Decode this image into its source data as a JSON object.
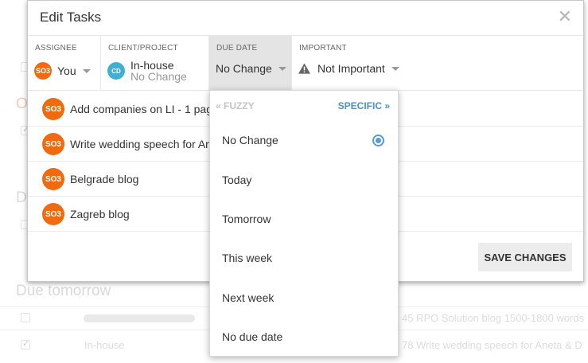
{
  "background": {
    "heading_due_tomorrow": "Due tomorrow",
    "heading_o": "O",
    "heading_d": "D",
    "row_client": "In-house",
    "row1_task": "45 RPO Solution blog 1500-1800 words",
    "row2_task": "78 Write wedding speech for Aneta & D"
  },
  "modal": {
    "title": "Edit Tasks",
    "close_glyph": "✕",
    "fields": {
      "assignee": {
        "label": "ASSIGNEE",
        "avatar": "SO3",
        "value": "You"
      },
      "client": {
        "label": "CLIENT/PROJECT",
        "avatar": "CD",
        "value": "In-house",
        "sub": "No Change"
      },
      "due": {
        "label": "DUE DATE",
        "value": "No Change"
      },
      "important": {
        "label": "IMPORTANT",
        "value": "Not Important",
        "icon": "warning-icon"
      }
    },
    "tasks": [
      {
        "avatar": "SO3",
        "name": "Add companies on LI - 1 pag"
      },
      {
        "avatar": "SO3",
        "name": "Write wedding speech for Ane"
      },
      {
        "avatar": "SO3",
        "name": "Belgrade blog"
      },
      {
        "avatar": "SO3",
        "name": "Zagreb blog"
      }
    ],
    "save_label": "SAVE CHANGES"
  },
  "dropdown": {
    "fuzzy_label": "« FUZZY",
    "specific_label": "SPECIFIC »",
    "selected": "No Change",
    "options": [
      "No Change",
      "Today",
      "Tomorrow",
      "This week",
      "Next week",
      "No due date"
    ]
  },
  "colors": {
    "avatar_orange": "#f06a0f",
    "client_avatar_blue": "#3fb0d4",
    "accent_blue": "#4a90c9"
  }
}
